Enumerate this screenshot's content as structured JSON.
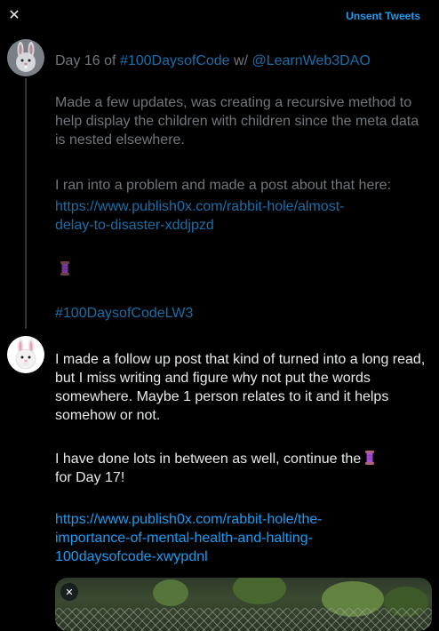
{
  "topbar": {
    "close_label": "✕",
    "unsent_label": "Unsent Tweets"
  },
  "tweet1": {
    "title_prefix": "Day 16 of ",
    "title_hashtag": "#100DaysofCode",
    "title_middle": " w/ ",
    "title_mention": "@LearnWeb3DAO",
    "para1": "Made a few updates, was creating a recursive method to help display the children with children since the meta data is nested elsewhere.",
    "para2": "I ran into a problem and made a post about that here:",
    "link": "https://www.publish0x.com/rabbit-hole/almost-delay-to-disaster-xddjpzd",
    "link_line1": "https://www.publish0x.com/rabbit-hole/almost-",
    "link_line2": "delay-to-disaster-xddjpzd",
    "hashtag_footer": "#100DaysofCodeLW3",
    "emoji": "spool-of-thread-icon"
  },
  "tweet2": {
    "para1": "I made a follow up post that kind of turned into a long read, but I miss writing and figure why not put the words somewhere. Maybe 1 person relates to it and it helps somehow or not.",
    "para2_before": "I have done lots in between as well, continue the ",
    "para2_after": "for Day 17!",
    "emoji": "spool-of-thread-icon",
    "link": "https://www.publish0x.com/rabbit-hole/the-importance-of-mental-health-and-halting-100daysofcode-xwypdnl",
    "link_line1": "https://www.publish0x.com/rabbit-hole/the-",
    "link_line2": "importance-of-mental-health-and-halting-",
    "link_line3": "100daysofcode-xwypdnl",
    "media_remove_label": "✕"
  },
  "colors": {
    "background": "#000000",
    "accent": "#1d9bf0",
    "muted": "#71767b",
    "text": "#e7e9ea"
  }
}
